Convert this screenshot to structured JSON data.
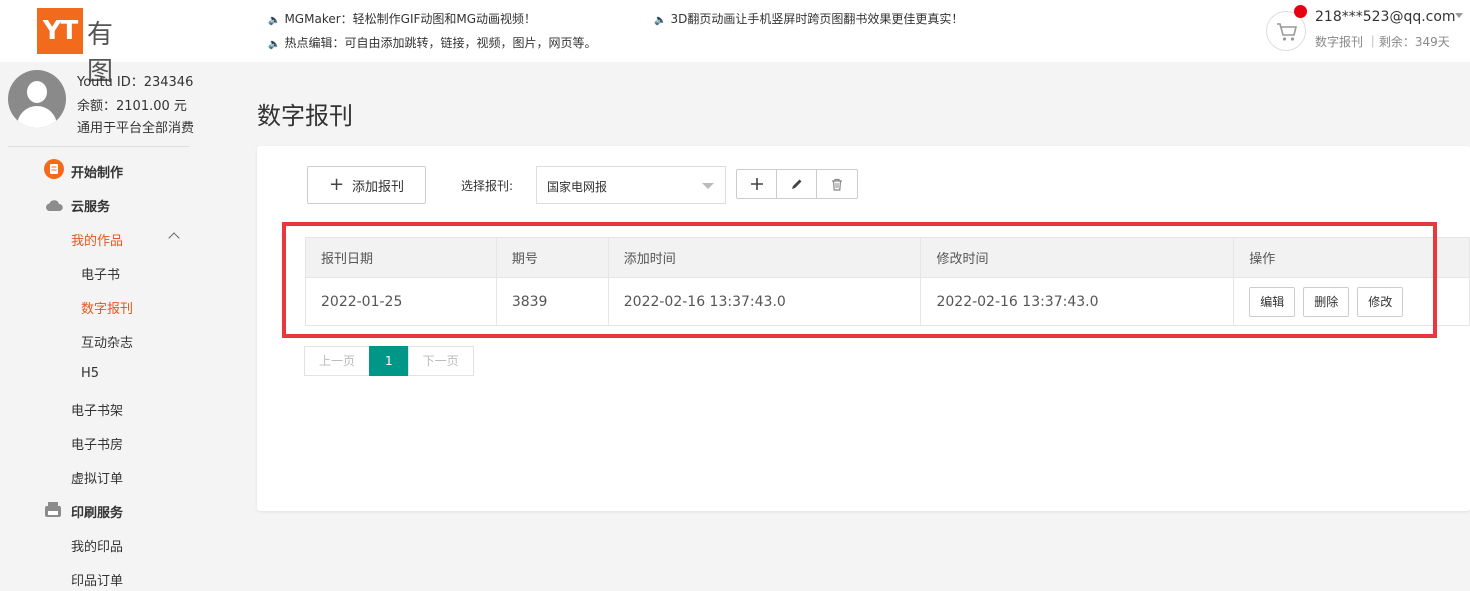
{
  "brand": {
    "logo_mark": "YT",
    "logo_text": "有图"
  },
  "announcements": [
    "MGMaker：轻松制作GIF动图和MG动画视频！",
    "热点编辑：可自由添加跳转，链接，视频，图片，网页等。",
    "3D翻页动画让手机竖屏时跨页图翻书效果更佳更真实！"
  ],
  "account": {
    "email": "218***523@qq.com",
    "plan": "数字报刊",
    "remaining": "｜剩余：349天"
  },
  "user": {
    "id_line": "Youtu ID：234346",
    "balance_line": "余额：2101.00 元",
    "note": "通用于平台全部消费"
  },
  "sidebar": {
    "start": "开始制作",
    "cloud": "云服务",
    "my_works": "我的作品",
    "ebook": "电子书",
    "digital_paper": "数字报刊",
    "magazine": "互动杂志",
    "h5": "H5",
    "bookshelf": "电子书架",
    "bookroom": "电子书房",
    "virtual_order": "虚拟订单",
    "print": "印刷服务",
    "my_prints": "我的印品",
    "print_orders": "印品订单"
  },
  "page": {
    "title": "数字报刊",
    "add_button": "添加报刊",
    "select_label": "选择报刊:",
    "select_value": "国家电网报"
  },
  "table": {
    "headers": [
      "报刊日期",
      "期号",
      "添加时间",
      "修改时间",
      "操作"
    ],
    "rows": [
      {
        "date": "2022-01-25",
        "issue": "3839",
        "added": "2022-02-16 13:37:43.0",
        "modified": "2022-02-16 13:37:43.0",
        "actions": [
          "编辑",
          "删除",
          "修改"
        ]
      }
    ]
  },
  "pagination": {
    "prev": "上一页",
    "current": "1",
    "next": "下一页"
  },
  "colors": {
    "accent": "#e8561e",
    "brand": "#f26b1d",
    "highlight": "#e8383d",
    "page_active": "#009688"
  }
}
